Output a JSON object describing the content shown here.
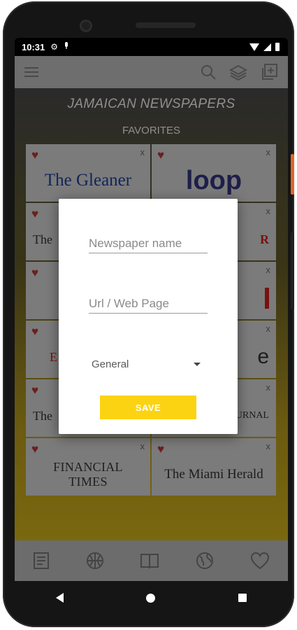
{
  "status_bar": {
    "time": "10:31",
    "icons": [
      "gear-icon",
      "mic-icon",
      "wifi-icon",
      "signal-icon",
      "battery-icon"
    ]
  },
  "app_bar": {
    "icons": [
      "menu-icon",
      "search-icon",
      "layers-icon",
      "add-box-icon"
    ]
  },
  "header": {
    "title": "JAMAICAN NEWSPAPERS",
    "section": "FAVORITES"
  },
  "favorites": [
    {
      "logo": "The Gleaner",
      "favorite": true,
      "close": "x"
    },
    {
      "logo": "loop",
      "favorite": true,
      "close": "x"
    },
    {
      "logo": "The",
      "favorite": true,
      "close": "x"
    },
    {
      "logo": "R",
      "favorite": true,
      "close": "x"
    },
    {
      "logo": "",
      "favorite": true,
      "close": "x"
    },
    {
      "logo": "",
      "favorite": true,
      "close": "x"
    },
    {
      "logo": "E",
      "favorite": true,
      "close": "x"
    },
    {
      "logo": "e",
      "favorite": true,
      "close": "x"
    },
    {
      "logo": "The",
      "favorite": true,
      "close": "x"
    },
    {
      "logo": "URNAL",
      "favorite": true,
      "close": "x"
    },
    {
      "logo": "FINANCIAL TIMES",
      "favorite": true,
      "close": "x"
    },
    {
      "logo": "The Miami Herald",
      "favorite": true,
      "close": "x"
    }
  ],
  "bottom_nav": {
    "icons": [
      "news-icon",
      "basketball-icon",
      "book-icon",
      "globe-icon",
      "heart-icon"
    ]
  },
  "dialog": {
    "name_placeholder": "Newspaper name",
    "url_placeholder": "Url / Web Page",
    "category_selected": "General",
    "save_label": "SAVE"
  },
  "colors": {
    "accent": "#FCD312",
    "heart": "#C0392B",
    "dialog_bg": "#FFFFFF"
  }
}
